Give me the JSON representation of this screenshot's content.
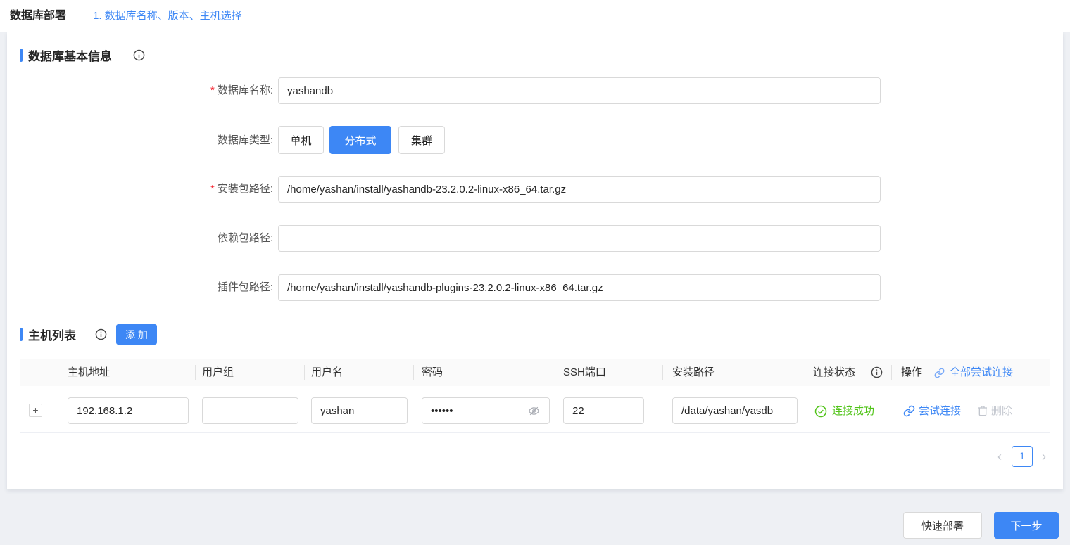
{
  "topbar": {
    "app_title": "数据库部署",
    "step_title": "1. 数据库名称、版本、主机选择"
  },
  "required_mark": "*",
  "basic_info": {
    "section_title": "数据库基本信息",
    "name_label": "数据库名称:",
    "name_value": "yashandb",
    "type_label": "数据库类型:",
    "type_options": [
      "单机",
      "分布式",
      "集群"
    ],
    "type_selected": "分布式",
    "install_label": "安装包路径:",
    "install_value": "/home/yashan/install/yashandb-23.2.0.2-linux-x86_64.tar.gz",
    "dependency_label": "依赖包路径:",
    "dependency_value": "",
    "plugin_label": "插件包路径:",
    "plugin_value": "/home/yashan/install/yashandb-plugins-23.2.0.2-linux-x86_64.tar.gz"
  },
  "host_list": {
    "section_title": "主机列表",
    "add_button_label": "添 加",
    "columns": {
      "host": "主机地址",
      "group": "用户组",
      "user": "用户名",
      "password": "密码",
      "ssh": "SSH端口",
      "path": "安装路径",
      "status": "连接状态",
      "action": "操作"
    },
    "try_all_label": "全部尝试连接",
    "row": {
      "expander": "+",
      "host": "192.168.1.2",
      "group": "",
      "user": "yashan",
      "password": "••••••",
      "ssh": "22",
      "path": "/data/yashan/yasdb",
      "status": "连接成功",
      "try_label": "尝试连接",
      "delete_label": "删除"
    },
    "pagination": {
      "prev": "‹",
      "current": "1",
      "next": "›"
    }
  },
  "footer": {
    "quick_deploy_label": "快速部署",
    "next_label": "下一步"
  },
  "colors": {
    "accent": "#3d87f5",
    "success": "#52c41a",
    "danger": "#f5222d"
  }
}
